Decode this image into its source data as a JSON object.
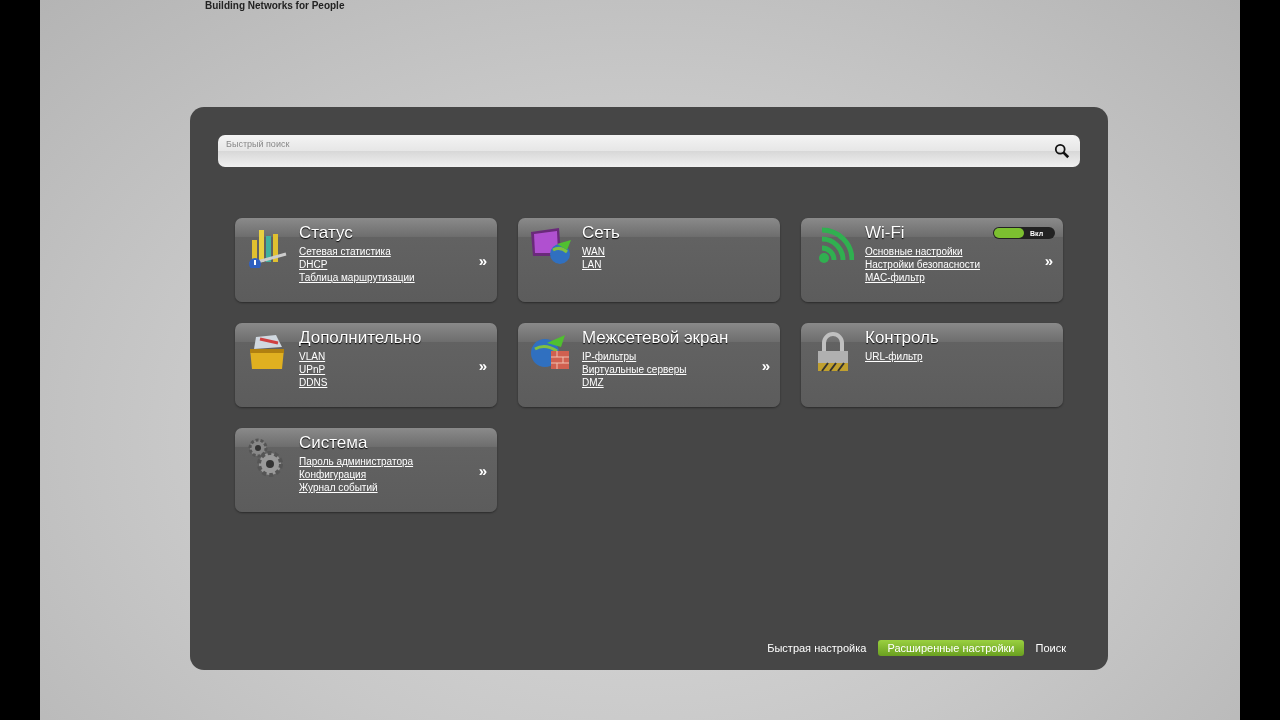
{
  "header": {
    "tagline": "Building Networks for People"
  },
  "search": {
    "placeholder": "Быстрый поиск"
  },
  "cards": [
    {
      "kind": "chart",
      "title": "Статус",
      "links": [
        "Сетевая статистика",
        "DHCP",
        "Таблица маршрутизации"
      ],
      "more": "»"
    },
    {
      "kind": "monitor",
      "title": "Сеть",
      "links": [
        "WAN",
        "LAN"
      ]
    },
    {
      "kind": "wifi",
      "title": "Wi-Fi",
      "links": [
        "Основные настройки",
        "Настройки безопасности",
        "MAC-фильтр"
      ],
      "more": "»",
      "toggle": {
        "on": true,
        "label": "Вкл"
      }
    },
    {
      "kind": "box",
      "title": "Дополнительно",
      "links": [
        "VLAN",
        "UPnP",
        "DDNS"
      ],
      "more": "»"
    },
    {
      "kind": "firewall",
      "title": "Межсетевой экран",
      "links": [
        "IP-фильтры",
        "Виртуальные серверы",
        "DMZ"
      ],
      "more": "»"
    },
    {
      "kind": "lock",
      "title": "Контроль",
      "links": [
        "URL-фильтр"
      ]
    },
    {
      "kind": "gears",
      "title": "Система",
      "links": [
        "Пароль администратора",
        "Конфигурация",
        "Журнал событий"
      ],
      "more": "»"
    }
  ],
  "footer": [
    {
      "label": "Быстрая настройка",
      "selected": false
    },
    {
      "label": "Расширенные настройки",
      "selected": true
    },
    {
      "label": "Поиск",
      "selected": false
    }
  ]
}
